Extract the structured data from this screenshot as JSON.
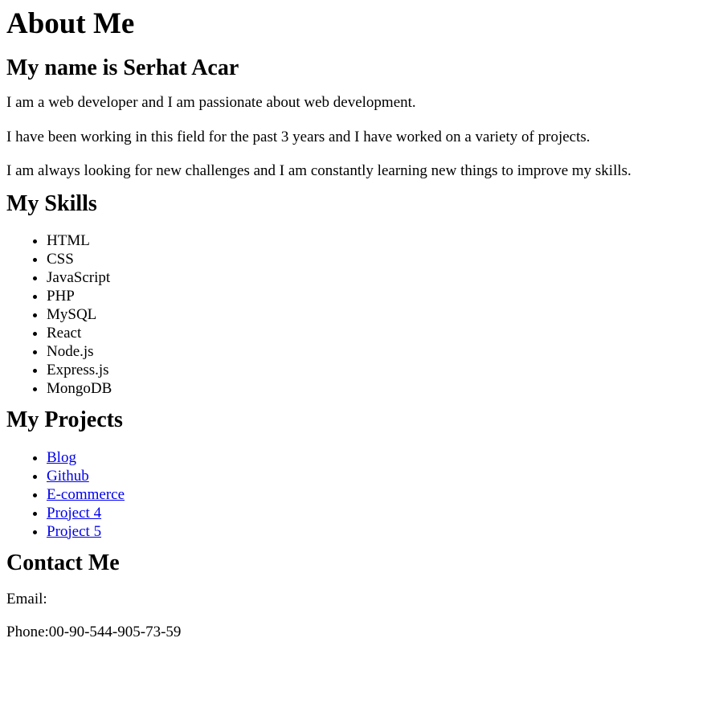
{
  "page_title": "About Me",
  "name_heading": "My name is Serhat Acar",
  "intro": [
    "I am a web developer and I am passionate about web development.",
    "I have been working in this field for the past 3 years and I have worked on a variety of projects.",
    "I am always looking for new challenges and I am constantly learning new things to improve my skills."
  ],
  "skills": {
    "heading": "My Skills",
    "items": [
      "HTML",
      "CSS",
      "JavaScript",
      "PHP",
      "MySQL",
      "React",
      "Node.js",
      "Express.js",
      "MongoDB"
    ]
  },
  "projects": {
    "heading": "My Projects",
    "items": [
      "Blog",
      "Github",
      "E-commerce",
      "Project 4",
      "Project 5"
    ]
  },
  "contact": {
    "heading": "Contact Me",
    "email_label": "Email:",
    "phone_label": "Phone:",
    "phone_value": "00-90-544-905-73-59"
  },
  "colors": {
    "text": "#000000",
    "link": "#0000ee",
    "background": "#ffffff"
  }
}
